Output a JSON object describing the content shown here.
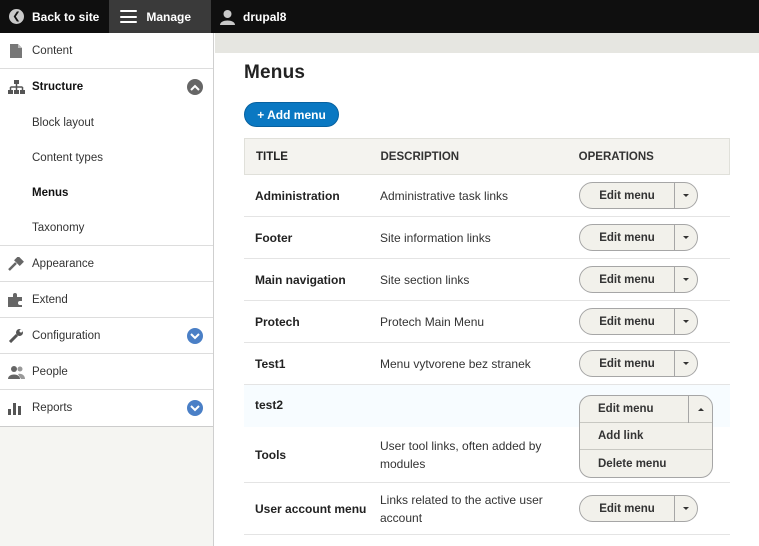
{
  "toolbar": {
    "back_label": "Back to site",
    "manage_label": "Manage",
    "user_label": "drupal8"
  },
  "sidebar": {
    "items": [
      {
        "label": "Content",
        "icon": "file-icon"
      },
      {
        "label": "Structure",
        "icon": "sitemap-icon",
        "expanded": true,
        "children": [
          "Block layout",
          "Content types",
          "Menus",
          "Taxonomy"
        ],
        "active_child": "Menus"
      },
      {
        "label": "Appearance",
        "icon": "brush-icon"
      },
      {
        "label": "Extend",
        "icon": "puzzle-icon"
      },
      {
        "label": "Configuration",
        "icon": "wrench-icon",
        "collapsible": true
      },
      {
        "label": "People",
        "icon": "people-icon"
      },
      {
        "label": "Reports",
        "icon": "bar-chart-icon",
        "collapsible": true
      }
    ]
  },
  "main": {
    "title": "Menus",
    "add_button": "+ Add menu",
    "table": {
      "headers": [
        "TITLE",
        "DESCRIPTION",
        "OPERATIONS"
      ],
      "rows": [
        {
          "title": "Administration",
          "description": "Administrative task links",
          "op": "Edit menu"
        },
        {
          "title": "Footer",
          "description": "Site information links",
          "op": "Edit menu"
        },
        {
          "title": "Main navigation",
          "description": "Site section links",
          "op": "Edit menu"
        },
        {
          "title": "Protech",
          "description": "Protech Main Menu",
          "op": "Edit menu"
        },
        {
          "title": "Test1",
          "description": "Menu vytvorene bez stranek",
          "op": "Edit menu"
        },
        {
          "title": "test2",
          "description": "",
          "op": "Edit menu"
        },
        {
          "title": "Tools",
          "description": "User tool links, often added by modules",
          "op": ""
        },
        {
          "title": "User account menu",
          "description": "Links related to the active user account",
          "op": "Edit menu"
        }
      ],
      "open_dropdown": [
        "Edit menu",
        "Add link",
        "Delete menu"
      ]
    }
  },
  "colors": {
    "toolbar_bg": "#0f0f0f",
    "primary_blue": "#0a78c2",
    "toggle_blue": "#4a7fc6"
  }
}
